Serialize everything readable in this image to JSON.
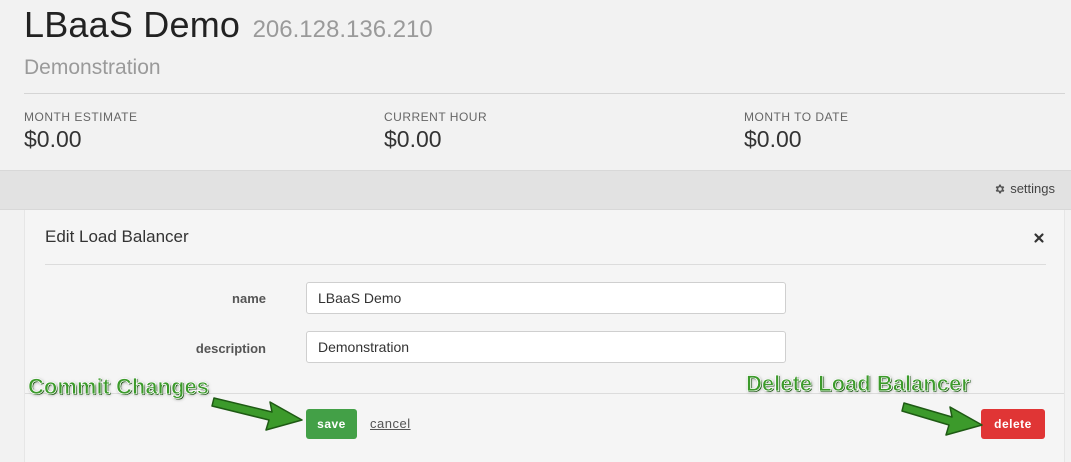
{
  "header": {
    "name": "LBaaS Demo",
    "ip": "206.128.136.210",
    "description": "Demonstration"
  },
  "stats": [
    {
      "label": "MONTH ESTIMATE",
      "value": "$0.00"
    },
    {
      "label": "CURRENT HOUR",
      "value": "$0.00"
    },
    {
      "label": "MONTH TO DATE",
      "value": "$0.00"
    }
  ],
  "toolbar": {
    "settings_label": "settings",
    "settings_icon": "gear-icon"
  },
  "panel": {
    "title": "Edit Load Balancer",
    "close_icon": "close-icon",
    "fields": {
      "name": {
        "label": "name",
        "value": "LBaaS Demo"
      },
      "description": {
        "label": "description",
        "value": "Demonstration"
      }
    },
    "actions": {
      "save_label": "save",
      "cancel_label": "cancel",
      "delete_label": "delete"
    }
  },
  "annotations": {
    "commit": "Commit Changes",
    "delete": "Delete Load Balancer",
    "color": "#3c9a2b"
  },
  "colors": {
    "save_button": "#43a047",
    "delete_button": "#e03535",
    "background": "#f2f2f2",
    "settings_bar": "#e2e2e2"
  }
}
